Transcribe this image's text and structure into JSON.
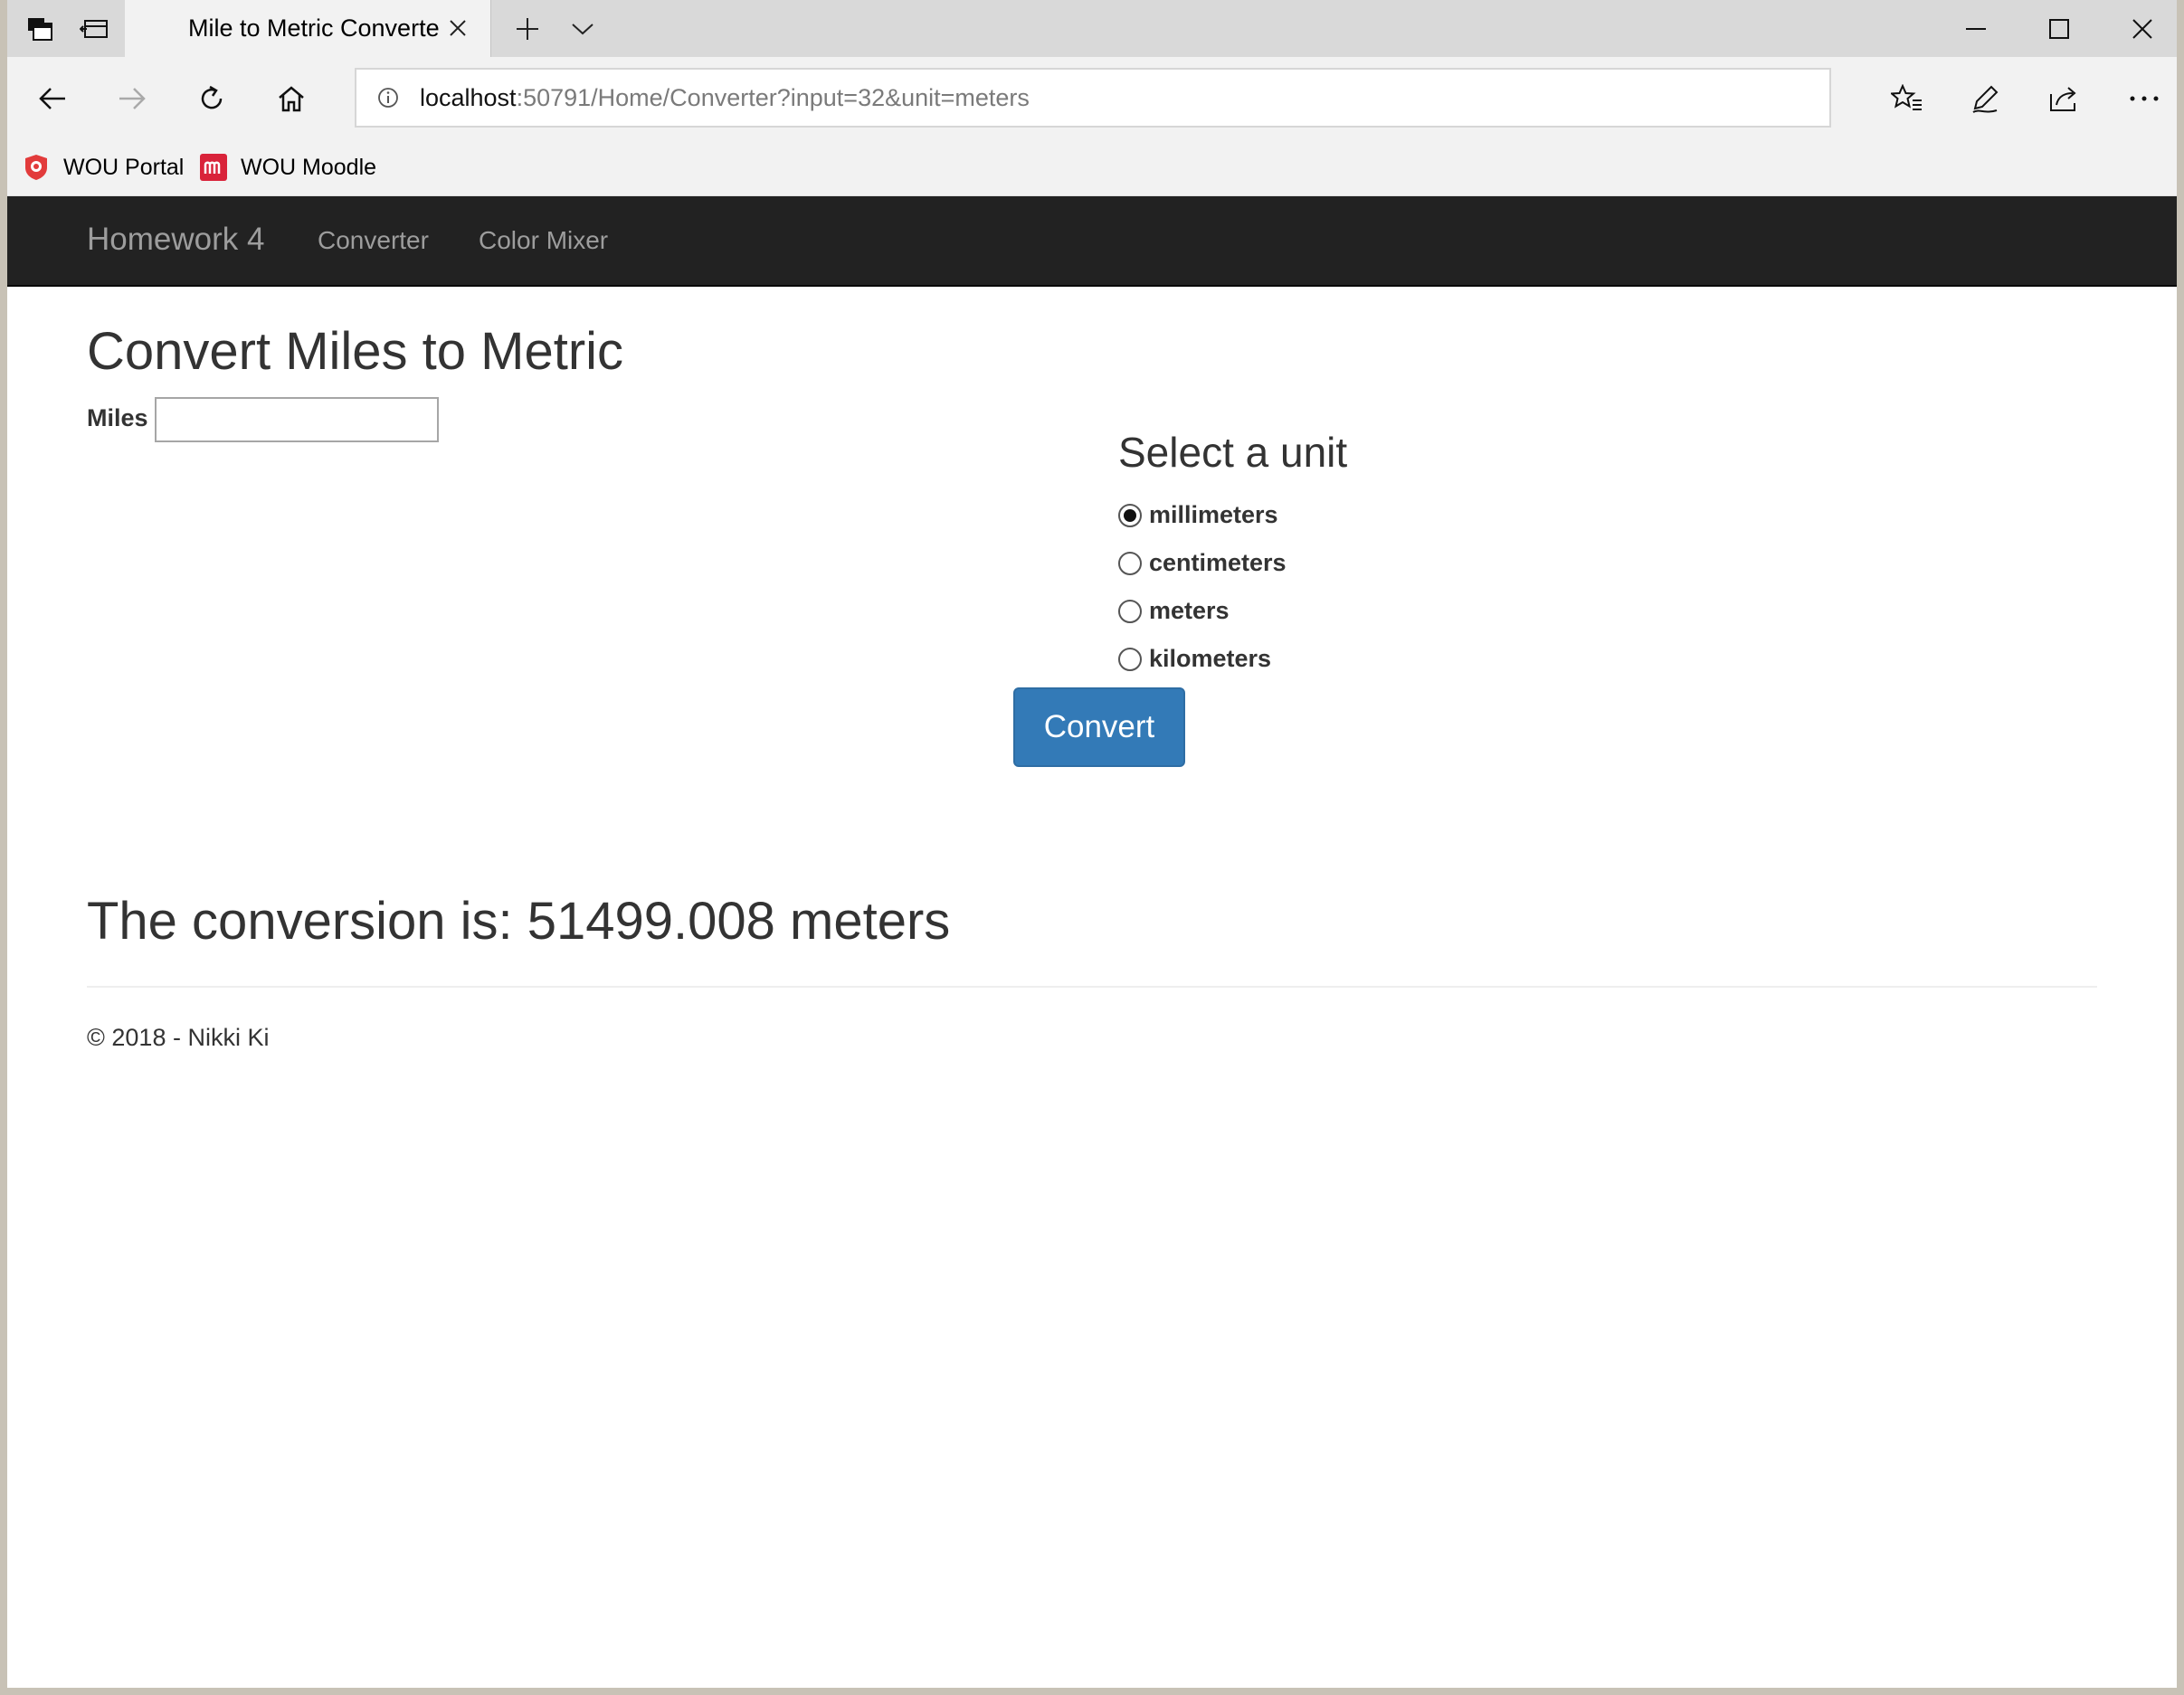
{
  "browser": {
    "tab_title": "Mile to Metric Converte",
    "url_host": "localhost",
    "url_rest": ":50791/Home/Converter?input=32&unit=meters",
    "favorites": [
      {
        "label": "WOU Portal",
        "icon": "shield-icon"
      },
      {
        "label": "WOU Moodle",
        "icon": "moodle-icon"
      }
    ]
  },
  "navbar": {
    "brand": "Homework 4",
    "links": [
      "Converter",
      "Color Mixer"
    ]
  },
  "page": {
    "title": "Convert Miles to Metric",
    "miles_label": "Miles",
    "miles_value": "",
    "unit_heading": "Select a unit",
    "units": [
      {
        "label": "millimeters",
        "checked": true
      },
      {
        "label": "centimeters",
        "checked": false
      },
      {
        "label": "meters",
        "checked": false
      },
      {
        "label": "kilometers",
        "checked": false
      }
    ],
    "convert_label": "Convert",
    "result_text": "The conversion is: 51499.008 meters",
    "footer_text": "© 2018 - Nikki Ki"
  },
  "colors": {
    "navbar_bg": "#222222",
    "navbar_text": "#9d9d9d",
    "primary_button": "#337ab7"
  }
}
